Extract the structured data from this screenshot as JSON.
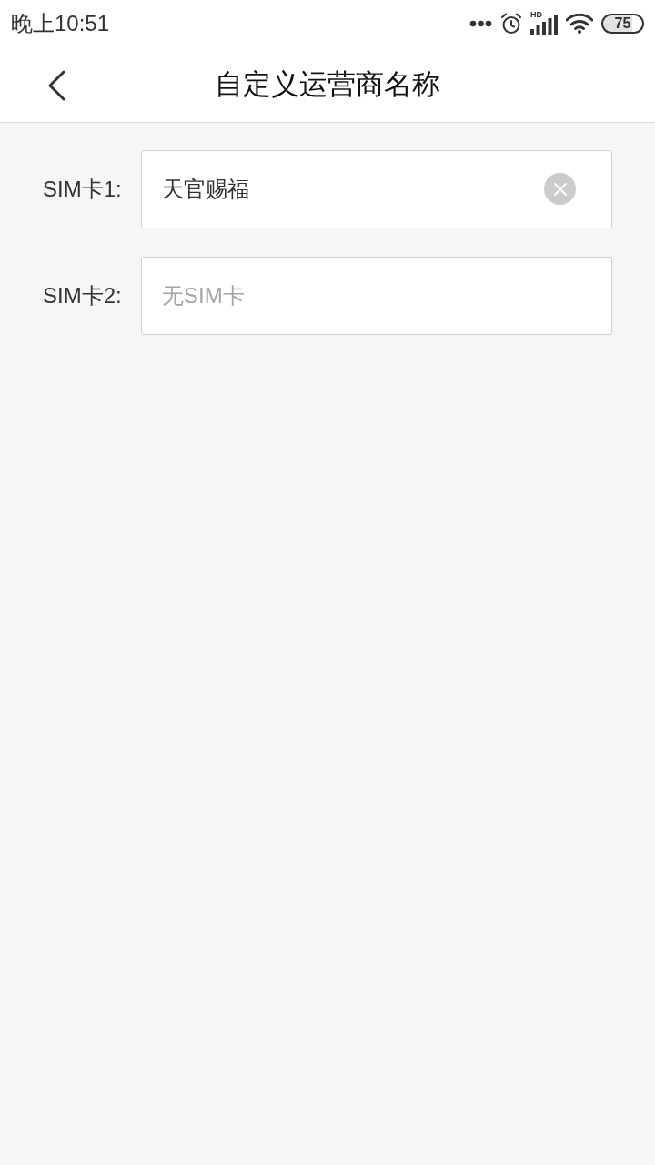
{
  "status_bar": {
    "time": "晚上10:51",
    "network_label": "HD",
    "battery": "75"
  },
  "header": {
    "title": "自定义运营商名称"
  },
  "fields": [
    {
      "label": "SIM卡1:",
      "value": "天官赐福",
      "clear_button": true
    },
    {
      "label": "SIM卡2:",
      "placeholder": "无SIM卡",
      "clear_button": false
    }
  ]
}
